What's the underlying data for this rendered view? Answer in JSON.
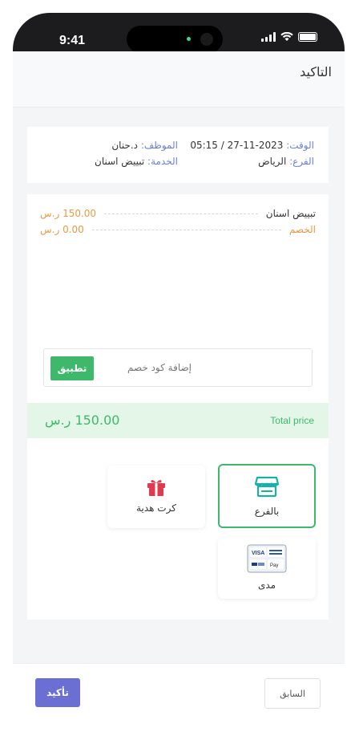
{
  "status_bar": {
    "time": "9:41"
  },
  "header": {
    "title": "التاكيد"
  },
  "appointment": {
    "time_label": "الوقت:",
    "time_value": "2023-11-27 / 05:15",
    "branch_label": "الفرع:",
    "branch_value": "الرياض",
    "employee_label": "الموظف:",
    "employee_value": "د.حنان",
    "service_label": "الخدمة:",
    "service_value": "تبييض اسنان"
  },
  "summary": {
    "items": [
      {
        "label": "تبييض اسنان",
        "value": "150.00 ر.س"
      },
      {
        "label": "الخصم",
        "value": "0.00 ر.س"
      }
    ],
    "coupon_placeholder": "إضافة كود خصم",
    "apply_label": "تطبيق",
    "total_label": "Total price",
    "total_value": "150.00 ر.س"
  },
  "payment": {
    "options": [
      {
        "label": "بالفرع",
        "icon": "store-icon",
        "selected": true
      },
      {
        "label": "كرت هدية",
        "icon": "gift-icon",
        "selected": false
      },
      {
        "label": "مدى",
        "icon": "cards-icon",
        "selected": false
      }
    ],
    "cards_text": {
      "visa": "VISA",
      "pay": "Pay"
    }
  },
  "footer": {
    "confirm_label": "تأكيد",
    "previous_label": "السابق"
  },
  "colors": {
    "accent_green": "#3eb96b",
    "primary_purple": "#6b6fd4",
    "label_blue": "#6b7fd7",
    "discount_orange": "#e69a44"
  }
}
